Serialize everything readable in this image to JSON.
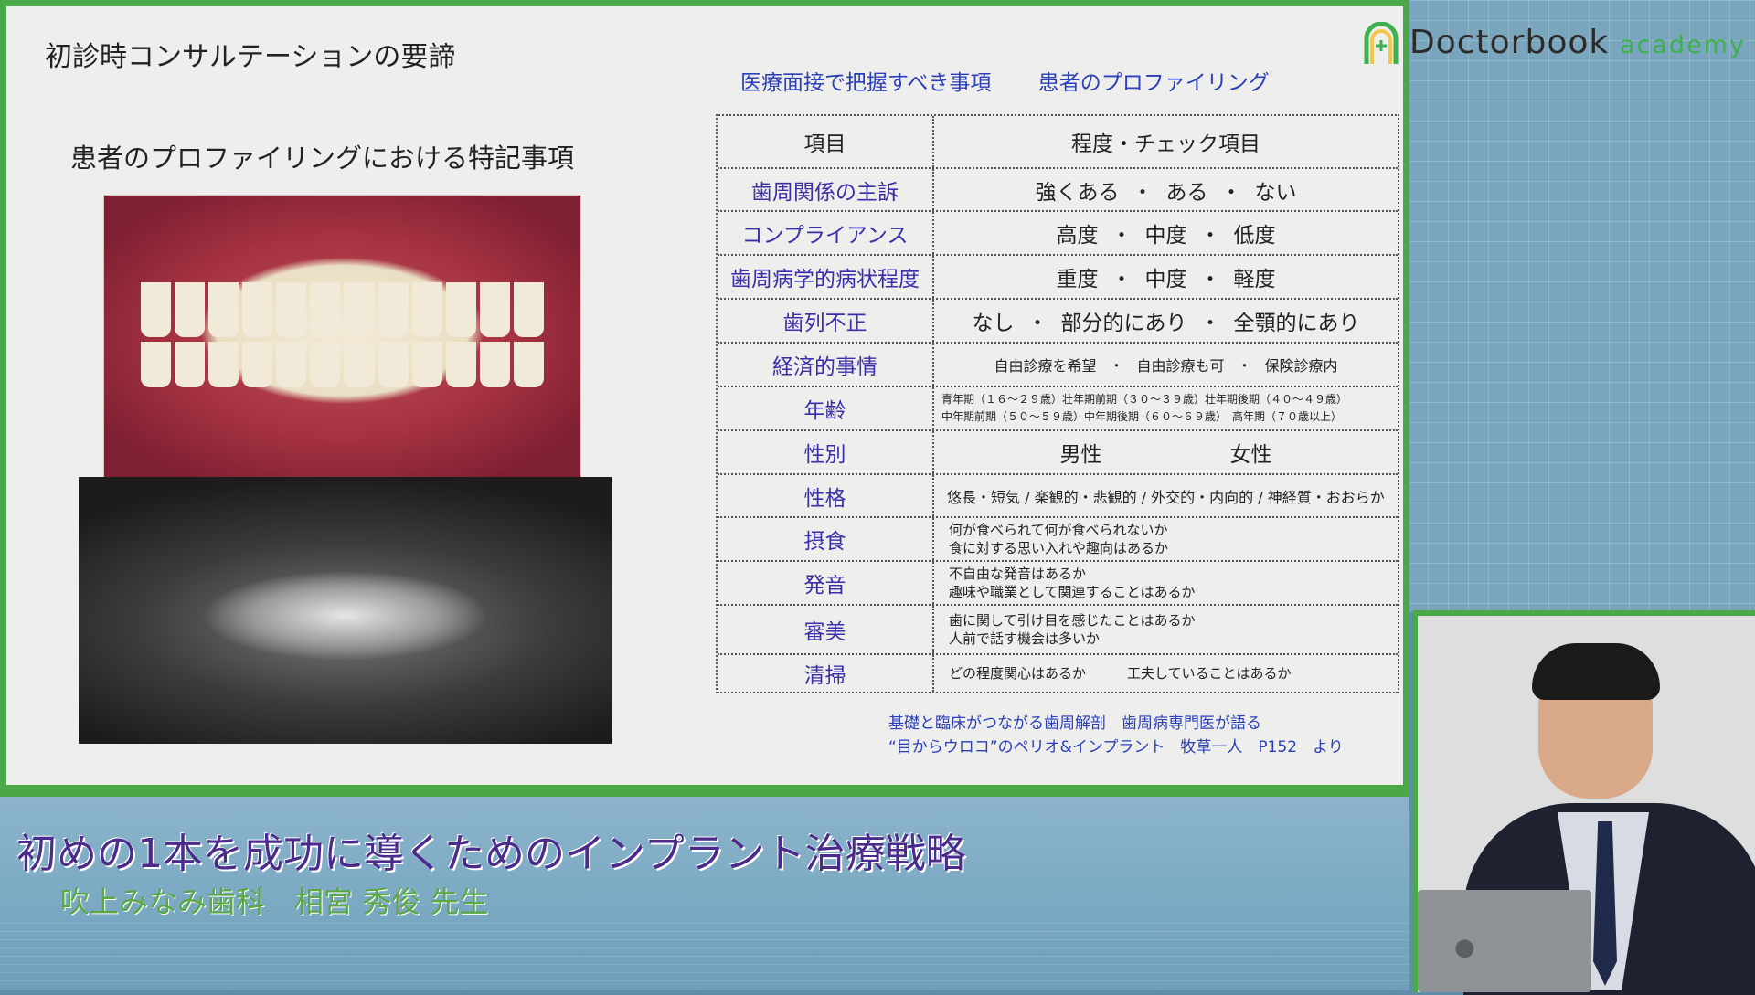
{
  "slide": {
    "title": "初診時コンサルテーションの要諦",
    "subtitle": "患者のプロファイリングにおける特記事項",
    "header_links": [
      "医療面接で把握すべき事項",
      "患者のプロファイリング"
    ]
  },
  "logo": {
    "name": "Doctorbook",
    "suffix": "academy"
  },
  "table": {
    "header": {
      "col1": "項目",
      "col2": "程度・チェック項目"
    },
    "rows": [
      {
        "item": "歯周関係の主訴",
        "options": [
          "強くある",
          "ある",
          "ない"
        ]
      },
      {
        "item": "コンプライアンス",
        "options": [
          "高度",
          "中度",
          "低度"
        ]
      },
      {
        "item": "歯周病学的病状程度",
        "options": [
          "重度",
          "中度",
          "軽度"
        ]
      },
      {
        "item": "歯列不正",
        "options": [
          "なし",
          "部分的にあり",
          "全顎的にあり"
        ]
      },
      {
        "item": "経済的事情",
        "options": [
          "自由診療を希望",
          "自由診療も可",
          "保険診療内"
        ]
      },
      {
        "item": "年齢",
        "lines": [
          "青年期（１６～２９歳）壮年期前期（３０～３９歳）壮年期後期（４０～４９歳）",
          "中年期前期（５０～５９歳）中年期後期（６０～６９歳）　高年期（７０歳以上）"
        ]
      },
      {
        "item": "性別",
        "options": [
          "男性",
          "女性"
        ]
      },
      {
        "item": "性格",
        "text": "悠長・短気 / 楽観的・悲観的 / 外交的・内向的 / 神経質・おおらか"
      },
      {
        "item": "摂食",
        "lines": [
          "何が食べられて何が食べられないか",
          "食に対する思い入れや趣向はあるか"
        ]
      },
      {
        "item": "発音",
        "lines": [
          "不自由な発音はあるか",
          "趣味や職業として関連することはあるか"
        ]
      },
      {
        "item": "審美",
        "lines": [
          "歯に関して引け目を感じたことはあるか",
          "人前で話す機会は多いか"
        ]
      },
      {
        "item": "清掃",
        "lines": [
          "どの程度関心はあるか　　　工夫していることはあるか"
        ]
      }
    ]
  },
  "reference": [
    "基礎と臨床がつながる歯周解剖　歯周病専門医が語る",
    "“目からウロコ”のペリオ&インプラント　牧草一人　P152　より"
  ],
  "banner": {
    "title": "初めの1本を成功に導くためのインプラント治療戦略",
    "subtitle": "吹上みなみ歯科　相宮 秀俊 先生"
  },
  "colors": {
    "accent_green": "#4aa848",
    "link_blue": "#2a3fb8",
    "item_purple": "#3a2fa8"
  }
}
